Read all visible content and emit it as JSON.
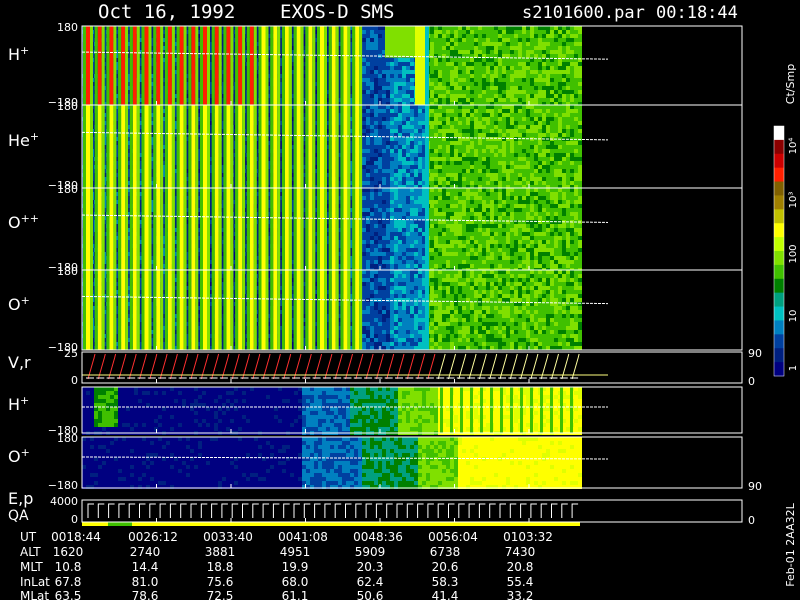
{
  "header": {
    "date": "Oct 16, 1992",
    "instrument": "EXOS-D SMS",
    "filename": "s2101600.par",
    "time": "00:18:44"
  },
  "footer_stamp": "Feb-01 2AA32L",
  "colorbar": {
    "unit": "Ct/Smp",
    "tick_labels": [
      "10⁴",
      "10³",
      "100",
      "10",
      "1"
    ],
    "stops": [
      "#ffffff",
      "#8b0000",
      "#cc0000",
      "#ff2000",
      "#806000",
      "#a08000",
      "#c0c000",
      "#ffff00",
      "#c0ff00",
      "#80e000",
      "#40c000",
      "#008000",
      "#00a080",
      "#00c0c0",
      "#0080c0",
      "#0040a0",
      "#002080",
      "#000080"
    ]
  },
  "chart_data": {
    "type": "heatmap",
    "x_axis_label_rows": {
      "labels": [
        "UT",
        "ALT",
        "MLT",
        "InLat",
        "MLat"
      ],
      "columns": [
        [
          "0018:44",
          "1620",
          "10.8",
          "67.8",
          "63.5"
        ],
        [
          "0026:12",
          "2740",
          "14.4",
          "81.0",
          "78.6"
        ],
        [
          "0033:40",
          "3881",
          "18.8",
          "75.6",
          "72.5"
        ],
        [
          "0041:08",
          "4951",
          "19.9",
          "68.0",
          "61.1"
        ],
        [
          "0048:36",
          "5909",
          "20.3",
          "62.4",
          "50.6"
        ],
        [
          "0056:04",
          "6738",
          "20.6",
          "58.3",
          "41.4"
        ],
        [
          "0103:32",
          "7430",
          "20.8",
          "55.4",
          "33.2"
        ]
      ]
    },
    "panels": [
      {
        "label": "H",
        "sup": "+",
        "y_top": "180",
        "y_bottom": "−180",
        "kind": "angle"
      },
      {
        "label": "He",
        "sup": "+",
        "y_top": "180",
        "y_bottom": "−180",
        "kind": "angle"
      },
      {
        "label": "O",
        "sup": "++",
        "y_top": "180",
        "y_bottom": "−180",
        "kind": "angle"
      },
      {
        "label": "O",
        "sup": "+",
        "y_top": "180",
        "y_bottom": "−180",
        "kind": "angle"
      },
      {
        "label": "V,r",
        "sup": "",
        "y_top": "25",
        "y_bottom": "0",
        "right_top": "90",
        "right_bottom": "0",
        "kind": "vr"
      },
      {
        "label": "H",
        "sup": "+",
        "y_top": "",
        "y_bottom": "−180",
        "kind": "angle2"
      },
      {
        "label": "O",
        "sup": "+",
        "y_top": "180",
        "y_bottom": "−180",
        "right_bottom": "90",
        "kind": "angle3"
      },
      {
        "label": "E,p",
        "label2": "QA",
        "sup": "",
        "y_top": "4000",
        "y_bottom": "0",
        "right_bottom": "0",
        "kind": "ep"
      }
    ]
  }
}
